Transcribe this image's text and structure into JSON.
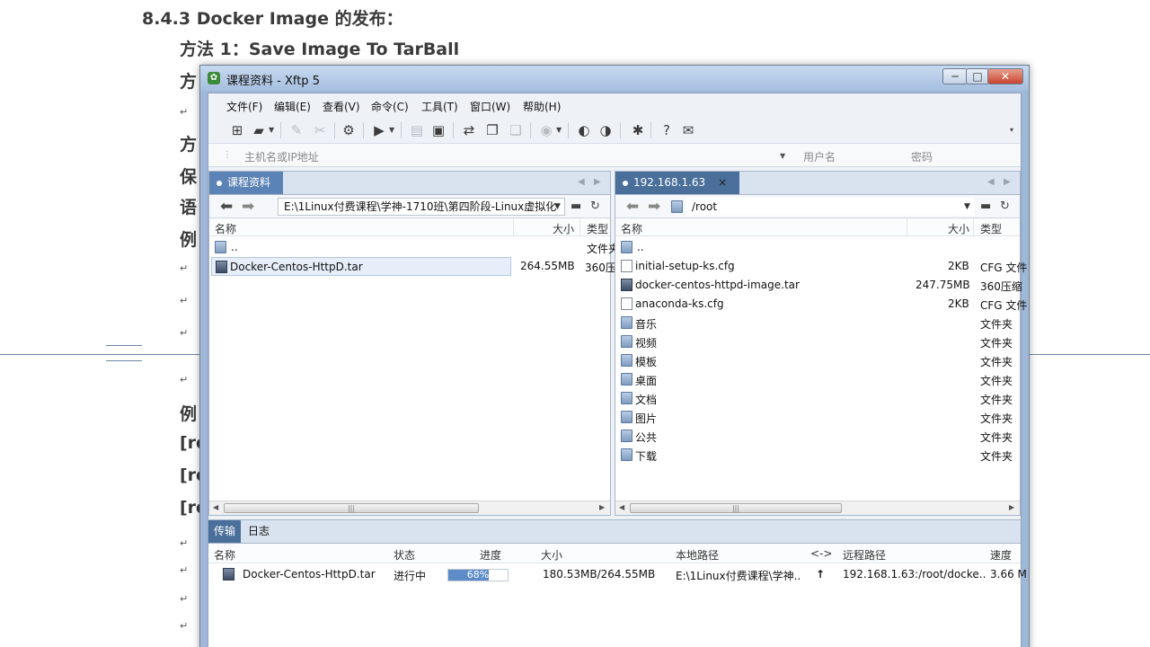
{
  "document": {
    "heading": "8.4.3    Docker Image  的发布：",
    "method1": "方法 1：Save Image To TarBall",
    "fragments": [
      "方",
      "方",
      "保",
      "语",
      "例",
      "例",
      "[ro",
      "[ro",
      "[ro"
    ],
    "return_mark": "↵"
  },
  "window": {
    "title": "课程资料 - Xftp 5",
    "controls": {
      "minimize": "─",
      "maximize": "□",
      "close": "✕"
    }
  },
  "menu": [
    "文件(F)",
    "编辑(E)",
    "查看(V)",
    "命令(C)",
    "工具(T)",
    "窗口(W)",
    "帮助(H)"
  ],
  "address_bar": {
    "host_placeholder": "主机名或IP地址",
    "user_placeholder": "用户名",
    "password_placeholder": "密码"
  },
  "left_pane": {
    "tab_label": "课程资料",
    "path": "E:\\1Linux付费课程\\学神-1710班\\第四阶段-Linux虚拟化",
    "columns": {
      "name": "名称",
      "size": "大小",
      "type": "类型"
    },
    "rows": [
      {
        "name": "..",
        "size": "",
        "type": "文件夹",
        "icon": "folder-icon"
      },
      {
        "name": "Docker-Centos-HttpD.tar",
        "size": "264.55MB",
        "type": "360压",
        "icon": "archive-icon"
      }
    ]
  },
  "right_pane": {
    "tab_label": "192.168.1.63",
    "path": "/root",
    "columns": {
      "name": "名称",
      "size": "大小",
      "type": "类型"
    },
    "rows": [
      {
        "name": "..",
        "size": "",
        "type": "",
        "icon": "folder-icon"
      },
      {
        "name": "initial-setup-ks.cfg",
        "size": "2KB",
        "type": "CFG 文件",
        "icon": "file-icon"
      },
      {
        "name": "docker-centos-httpd-image.tar",
        "size": "247.75MB",
        "type": "360压缩",
        "icon": "archive-icon"
      },
      {
        "name": "anaconda-ks.cfg",
        "size": "2KB",
        "type": "CFG 文件",
        "icon": "file-icon"
      },
      {
        "name": "音乐",
        "size": "",
        "type": "文件夹",
        "icon": "folder-icon"
      },
      {
        "name": "视频",
        "size": "",
        "type": "文件夹",
        "icon": "folder-icon"
      },
      {
        "name": "模板",
        "size": "",
        "type": "文件夹",
        "icon": "folder-icon"
      },
      {
        "name": "桌面",
        "size": "",
        "type": "文件夹",
        "icon": "folder-icon"
      },
      {
        "name": "文档",
        "size": "",
        "type": "文件夹",
        "icon": "folder-icon"
      },
      {
        "name": "图片",
        "size": "",
        "type": "文件夹",
        "icon": "folder-icon"
      },
      {
        "name": "公共",
        "size": "",
        "type": "文件夹",
        "icon": "folder-icon"
      },
      {
        "name": "下载",
        "size": "",
        "type": "文件夹",
        "icon": "folder-icon"
      }
    ]
  },
  "transfer": {
    "tabs": [
      "传输",
      "日志"
    ],
    "columns": {
      "name": "名称",
      "status": "状态",
      "progress": "进度",
      "size": "大小",
      "local_path": "本地路径",
      "direction": "<->",
      "remote_path": "远程路径",
      "speed": "速度"
    },
    "rows": [
      {
        "name": "Docker-Centos-HttpD.tar",
        "status": "进行中",
        "progress_label": "68%",
        "progress_value": 0.68,
        "size": "180.53MB/264.55MB",
        "local_path": "E:\\1Linux付费课程\\学神..",
        "direction": "↑",
        "remote_path": "192.168.1.63:/root/docke..",
        "speed": "3.66 M"
      }
    ]
  },
  "colors": {
    "accent": "#4a6f9b",
    "tab_active": "#5b83b5",
    "progress_fill": "#5d8cc9",
    "titlebar": "#b6cbe6"
  }
}
